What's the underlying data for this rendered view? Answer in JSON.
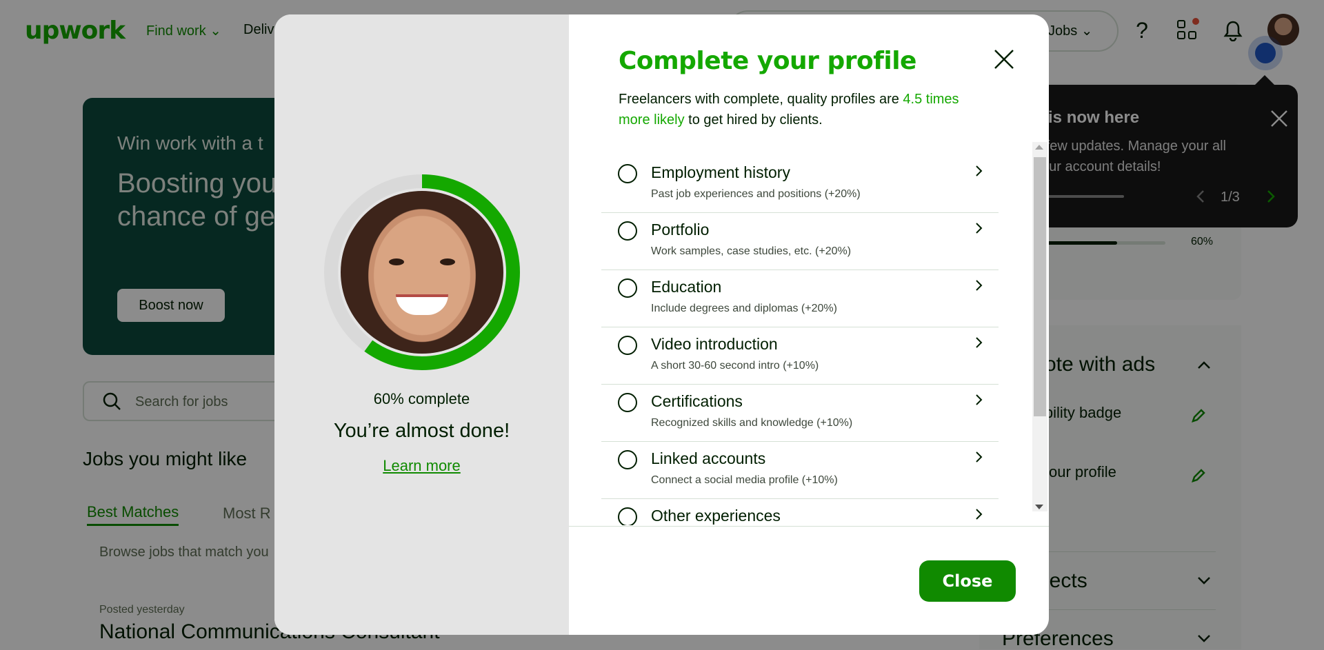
{
  "background": {
    "logo": "upwork",
    "nav": {
      "find_work": "Find work",
      "deliver": "Deliv",
      "jobs": "Jobs"
    },
    "promo": {
      "kicker": "Win work with a t",
      "title": "Boosting you chance of ge",
      "button": "Boost now"
    },
    "search_placeholder": "Search for jobs",
    "jobs_title": "Jobs you might like",
    "tabs": [
      "Best Matches",
      "Most R"
    ],
    "browse_text": "Browse jobs that match you",
    "posted": "Posted yesterday",
    "job_title": "National Communications Consultant",
    "side": {
      "progress_label": "60%",
      "progress_fraction": 0.6,
      "promote_title": "mote with ads",
      "badge": "ibility badge",
      "profile": "your profile",
      "connects": "nects",
      "preferences": "Preferences"
    },
    "tour": {
      "title": "e is now here",
      "body": "a few updates. Manage your all your account details!",
      "counter": "1/3"
    }
  },
  "modal": {
    "title": "Complete your profile",
    "subtitle_pre": "Freelancers with complete, quality profiles are ",
    "subtitle_highlight": "4.5 times more likely",
    "subtitle_post": " to get hired by clients.",
    "progress_percent": 60,
    "progress_label": "60% complete",
    "headline": "You’re almost done!",
    "learn_more": "Learn more",
    "close_button": "Close",
    "colors": {
      "accent": "#14a800",
      "button": "#108a00",
      "ring_track": "#d9d9d9"
    },
    "items": [
      {
        "title": "Employment history",
        "desc": "Past job experiences and positions (+20%)"
      },
      {
        "title": "Portfolio",
        "desc": "Work samples, case studies, etc. (+20%)"
      },
      {
        "title": "Education",
        "desc": "Include degrees and diplomas (+20%)"
      },
      {
        "title": "Video introduction",
        "desc": "A short 30-60 second intro (+10%)"
      },
      {
        "title": "Certifications",
        "desc": "Recognized skills and knowledge (+10%)"
      },
      {
        "title": "Linked accounts",
        "desc": "Connect a social media profile (+10%)"
      },
      {
        "title": "Other experiences",
        "desc": ""
      }
    ]
  }
}
